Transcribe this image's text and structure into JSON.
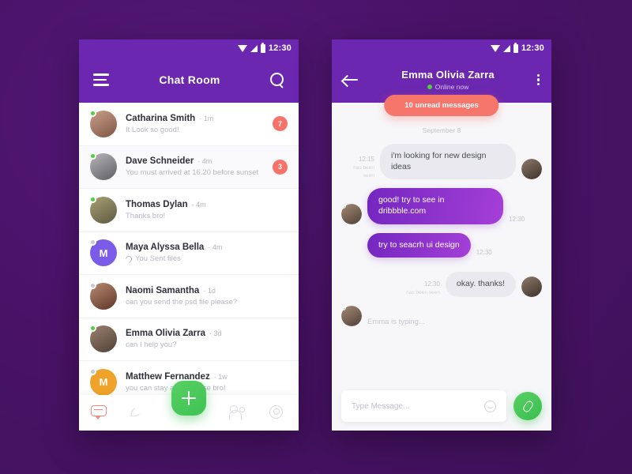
{
  "status_bar": {
    "time": "12:30",
    "icons": [
      "wifi-icon",
      "signal-icon",
      "battery-icon"
    ]
  },
  "colors": {
    "background": "#4a1268",
    "header_purple": "#6b27b0",
    "bubble_purple": "#7327bf",
    "badge_coral": "#f7736a",
    "accent_green": "#4cd137"
  },
  "left_screen": {
    "header": {
      "title": "Chat Room",
      "menu_icon": "hamburger-icon",
      "search_icon": "search-icon"
    },
    "chats": [
      {
        "name": "Catharina Smith",
        "time": "1m",
        "message": "It Look so good!",
        "badge": "7",
        "online": true,
        "avatar_type": "photo",
        "avatar_color": "#9b7b6a",
        "initial": ""
      },
      {
        "name": "Dave Schneider",
        "time": "4m",
        "message": "You must arrived at 16.20 before sunset",
        "badge": "3",
        "online": true,
        "avatar_type": "photo",
        "avatar_color": "#8d8d93",
        "initial": ""
      },
      {
        "name": "Thomas Dylan",
        "time": "4m",
        "message": "Thanks bro!",
        "badge": "",
        "online": true,
        "avatar_type": "photo",
        "avatar_color": "#8a8560",
        "initial": ""
      },
      {
        "name": "Maya Alyssa Bella",
        "time": "4m",
        "message": "You Sent files",
        "badge": "",
        "online": false,
        "avatar_type": "initial",
        "avatar_color": "#7b5ce8",
        "initial": "M",
        "attachment": true
      },
      {
        "name": "Naomi Samantha",
        "time": "1d",
        "message": "can you send the psd file please?",
        "badge": "",
        "online": false,
        "avatar_type": "photo",
        "avatar_color": "#7a4a3e",
        "initial": ""
      },
      {
        "name": "Emma Olivia Zarra",
        "time": "3d",
        "message": "can I help you?",
        "badge": "",
        "online": true,
        "avatar_type": "photo",
        "avatar_color": "#6b5a4e",
        "initial": ""
      },
      {
        "name": "Matthew Fernandez",
        "time": "1w",
        "message": "you can stay at my house bro!",
        "badge": "",
        "online": false,
        "avatar_type": "initial",
        "avatar_color": "#f0a32a",
        "initial": "M"
      }
    ],
    "bottom_nav": [
      {
        "name": "chat-tab",
        "icon": "chat-bubble-icon",
        "active": true
      },
      {
        "name": "calls-tab",
        "icon": "phone-icon",
        "active": false
      },
      {
        "name": "contacts-tab",
        "icon": "people-icon",
        "active": false
      },
      {
        "name": "settings-tab",
        "icon": "gear-icon",
        "active": false
      }
    ],
    "fab": {
      "icon": "plus-icon",
      "label": "+"
    }
  },
  "right_screen": {
    "header": {
      "back_icon": "back-arrow-icon",
      "name": "Emma Olivia Zarra",
      "status": "Online now",
      "more_icon": "more-vertical-icon"
    },
    "unread_pill": "10 unread messages",
    "day_separator": "September 8",
    "messages": [
      {
        "direction": "in",
        "text": "i'm looking for new design ideas",
        "time": "12:15",
        "seen": "has been seen",
        "avatar_color": "#5b4a42"
      },
      {
        "direction": "out",
        "text": "good! try to see in dribbble.com",
        "time": "12:30",
        "seen": "",
        "avatar_color": "#6b5a4e"
      },
      {
        "direction": "out",
        "text": "try to seacrh ui design",
        "time": "12:30",
        "seen": "",
        "avatar_color": ""
      },
      {
        "direction": "in",
        "text": "okay. thanks!",
        "time": "12:30",
        "seen": "has been seen",
        "avatar_color": "#5b4a42"
      }
    ],
    "typing_indicator": "Emma is typing...",
    "composer": {
      "placeholder": "Type Message...",
      "emoji_icon": "emoji-icon",
      "attach_icon": "paperclip-icon"
    }
  }
}
